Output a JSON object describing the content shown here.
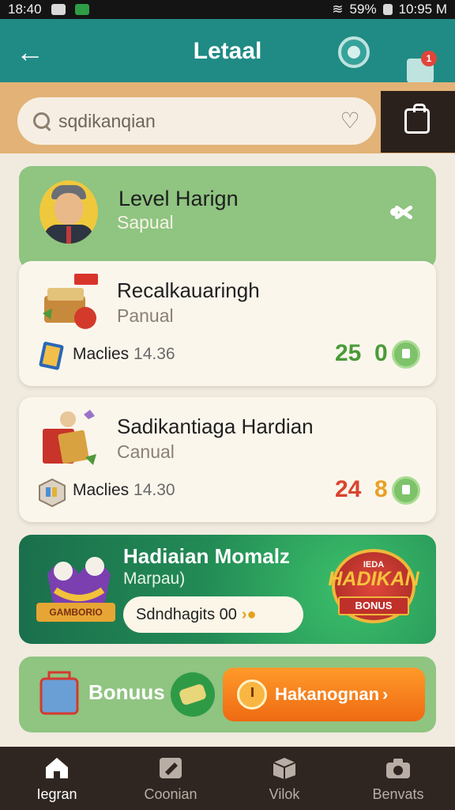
{
  "status_bar": {
    "time": "18:40",
    "battery": "59%",
    "clock": "10:95 M"
  },
  "header": {
    "title": "Letaal",
    "back_icon": "arrow-left-icon",
    "globe_icon": "globe-icon",
    "notification_icon": "bell-icon",
    "notification_count": "1"
  },
  "search": {
    "placeholder": "sqdikanqian",
    "icon": "search-icon",
    "favorite_icon": "heart-icon",
    "side_button_icon": "shopping-bag-icon"
  },
  "level_card": {
    "title": "Level Harign",
    "subtitle": "Sapual",
    "icon": "share-icon"
  },
  "tasks": [
    {
      "title": "Recalkauaringh",
      "subtitle": "Panual",
      "meta_label": "Maclies",
      "meta_value": "14.36",
      "score_main": "25",
      "score_sub": "0"
    },
    {
      "title": "Sadikantiaga Hardian",
      "subtitle": "Canual",
      "meta_label": "Maclies",
      "meta_value": "14.30",
      "score_main": "24",
      "score_sub": "8"
    }
  ],
  "event": {
    "title": "Hadiaian Momalz",
    "subtitle": "Marpau)",
    "ribbon": "GAMBORIO",
    "button_label": "Sdndhagits 00",
    "badge_top": "IEDA",
    "badge_main": "HADIKAN",
    "badge_ribbon": "BONUS"
  },
  "bonus": {
    "label": "Bonuus",
    "button_label": "Hakanognan"
  },
  "bottom_nav": [
    {
      "label": "Iegran",
      "icon": "home-icon",
      "active": true
    },
    {
      "label": "Coonian",
      "icon": "edit-icon",
      "active": false
    },
    {
      "label": "Vilok",
      "icon": "box-icon",
      "active": false
    },
    {
      "label": "Benvats",
      "icon": "camera-icon",
      "active": false
    }
  ],
  "colors": {
    "header": "#1f8b84",
    "search_strip": "#e2b277",
    "card_green": "#8fc481",
    "card_cream": "#fbf6ec",
    "event_green": "#228a55",
    "accent_orange": "#ef6a12",
    "nav_bg": "#2f2622"
  }
}
